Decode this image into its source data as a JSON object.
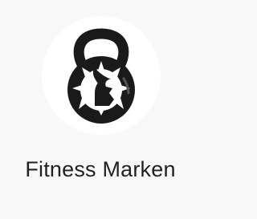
{
  "app": {
    "name": "Fitness Marken",
    "icon": "kettlebell-spartan-icon"
  },
  "colors": {
    "background": "#f8f8f8",
    "icon_circle": "#ffffff",
    "icon_ink": "#1a1a1a",
    "label_text": "#222222"
  }
}
